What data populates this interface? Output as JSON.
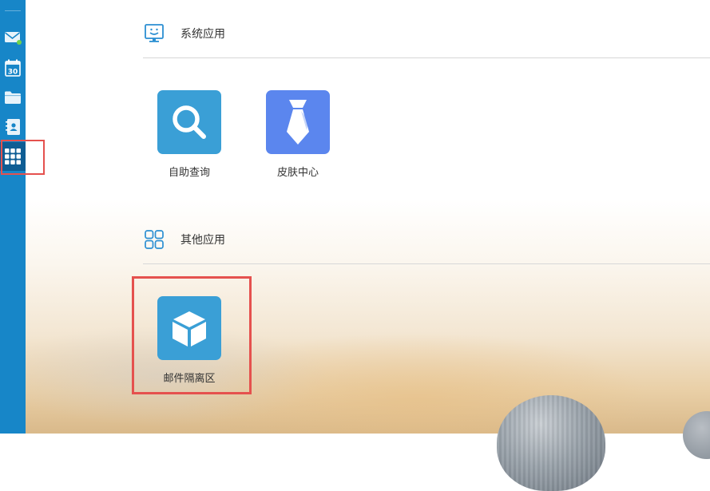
{
  "sections": {
    "system": {
      "title": "系统应用",
      "icon": "monitor-smile-icon",
      "apps": [
        {
          "label": "自助查询",
          "icon": "search-icon",
          "color": "#3a9fd6"
        },
        {
          "label": "皮肤中心",
          "icon": "tie-icon",
          "color": "#5b86ee"
        }
      ]
    },
    "other": {
      "title": "其他应用",
      "icon": "grid-four-icon",
      "apps": [
        {
          "label": "邮件隔离区",
          "icon": "cube-icon",
          "color": "#3a9fd6"
        }
      ]
    }
  },
  "sidebar": {
    "color": "#1786c8",
    "items": [
      {
        "icon": "mail-icon"
      },
      {
        "icon": "calendar-icon",
        "text": "30"
      },
      {
        "icon": "folder-icon"
      },
      {
        "icon": "contacts-icon"
      },
      {
        "icon": "apps-grid-icon",
        "active": true
      }
    ]
  },
  "highlight_color": "#e5514e"
}
